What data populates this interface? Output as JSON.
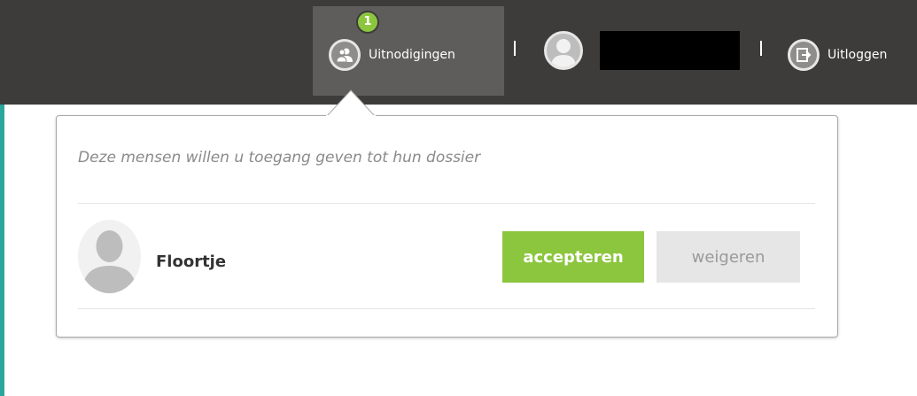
{
  "header": {
    "invitations_label": "Uitnodigingen",
    "invitations_count": "1",
    "logout_label": "Uitloggen",
    "separator": "|"
  },
  "invitations_popup": {
    "title": "Deze mensen willen u toegang geven tot hun dossier",
    "items": [
      {
        "name": "Floortje",
        "accept_label": "accepteren",
        "decline_label": "weigeren"
      }
    ]
  },
  "colors": {
    "topbar": "#3d3c3a",
    "accent_green": "#8cc63f",
    "decline_bg": "#e6e6e6"
  }
}
